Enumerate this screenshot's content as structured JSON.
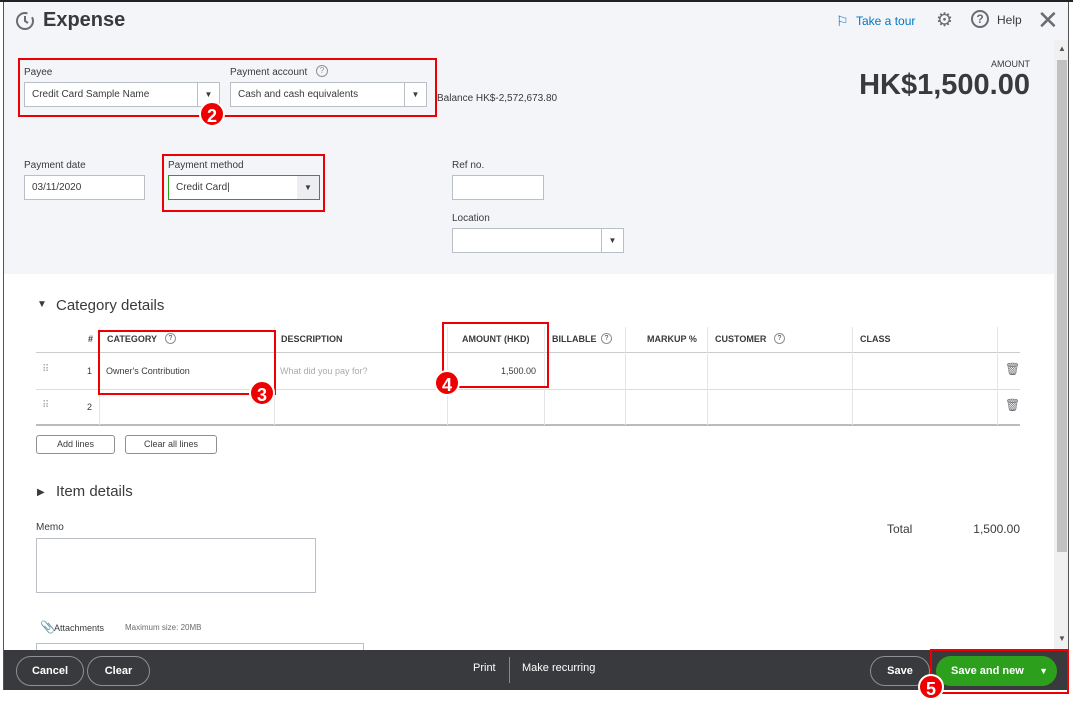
{
  "header": {
    "title": "Expense",
    "take_tour": "Take a tour",
    "help": "Help"
  },
  "payee": {
    "label": "Payee",
    "value": "Credit Card Sample Name"
  },
  "payment_account": {
    "label": "Payment account",
    "value": "Cash and cash equivalents",
    "balance": "Balance HK$-2,572,673.80"
  },
  "amount": {
    "label": "AMOUNT",
    "value": "HK$1,500.00"
  },
  "payment_date": {
    "label": "Payment date",
    "value": "03/11/2020"
  },
  "payment_method": {
    "label": "Payment method",
    "value": "Credit Card"
  },
  "ref_no": {
    "label": "Ref no.",
    "value": ""
  },
  "location": {
    "label": "Location",
    "value": ""
  },
  "category_details": {
    "title": "Category details",
    "columns": [
      "#",
      "CATEGORY",
      "DESCRIPTION",
      "AMOUNT (HKD)",
      "BILLABLE",
      "MARKUP %",
      "CUSTOMER",
      "CLASS"
    ],
    "rows": [
      {
        "num": "1",
        "category": "Owner's Contribution",
        "description_placeholder": "What did you pay for?",
        "amount": "1,500.00"
      },
      {
        "num": "2",
        "category": "",
        "amount": ""
      }
    ],
    "add_lines": "Add lines",
    "clear_all_lines": "Clear all lines"
  },
  "item_details": {
    "title": "Item details"
  },
  "memo": {
    "label": "Memo"
  },
  "total": {
    "label": "Total",
    "value": "1,500.00"
  },
  "attachments": {
    "label": "Attachments",
    "max_size": "Maximum size: 20MB"
  },
  "footer": {
    "cancel": "Cancel",
    "clear": "Clear",
    "print": "Print",
    "make_recurring": "Make recurring",
    "save": "Save",
    "save_and_new": "Save and new"
  },
  "badges": [
    "2",
    "3",
    "4",
    "5"
  ],
  "colors": {
    "accent_green": "#2ca01c",
    "link_blue": "#0077c5",
    "annotation_red": "#ee0000",
    "footer_bg": "#393a3d"
  }
}
